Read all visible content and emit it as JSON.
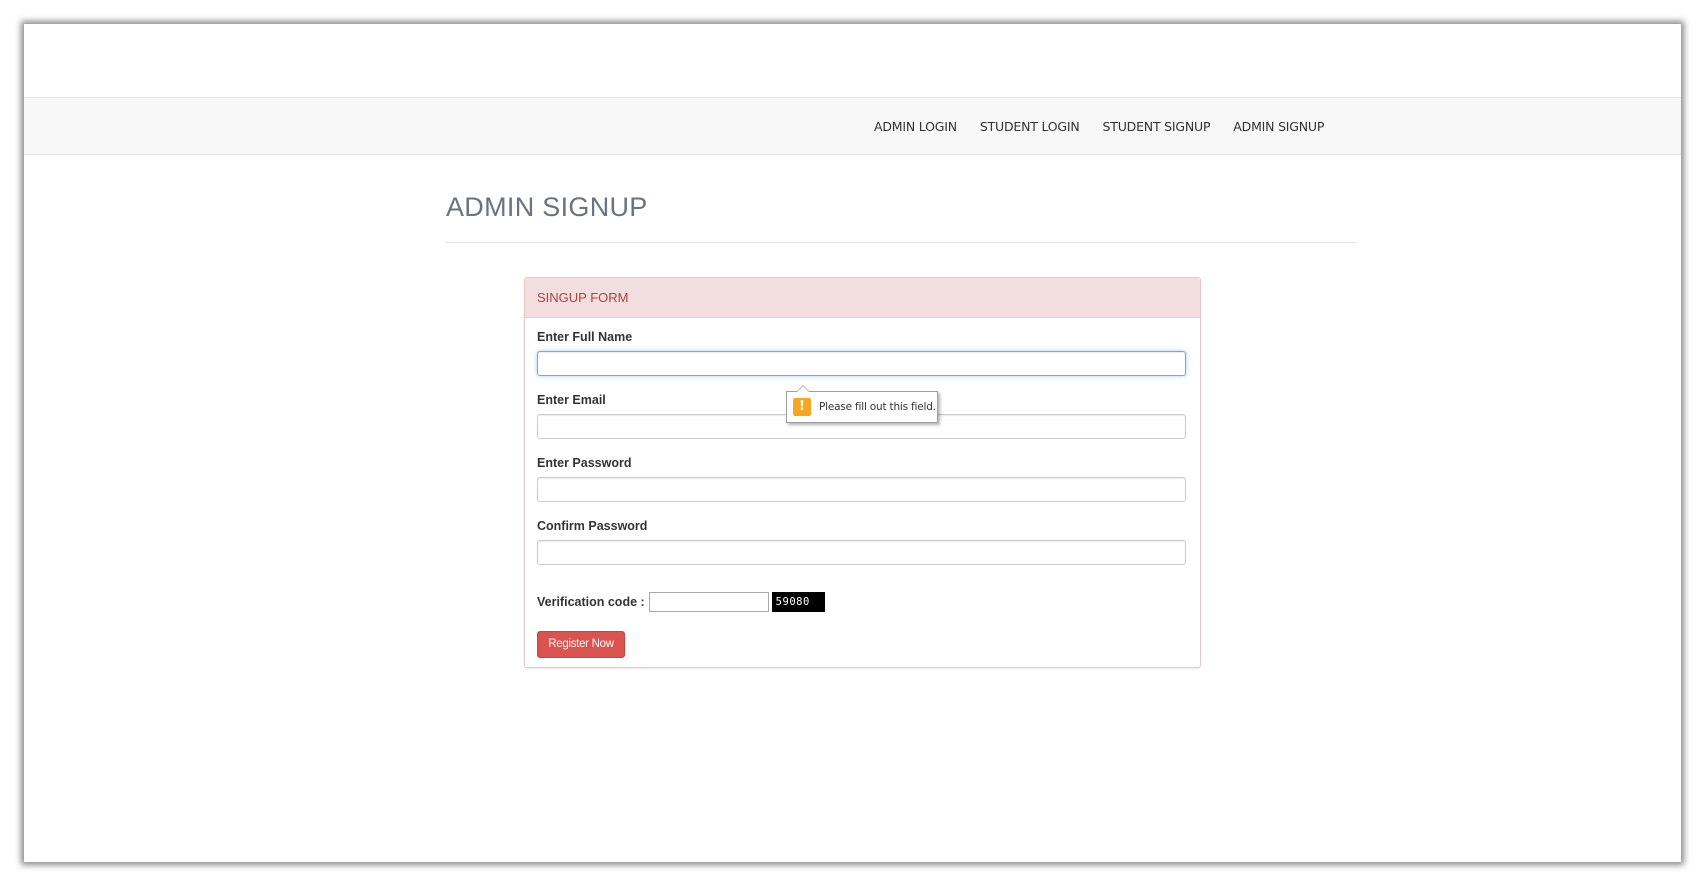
{
  "nav": {
    "items": [
      {
        "label": "ADMIN LOGIN"
      },
      {
        "label": "STUDENT LOGIN"
      },
      {
        "label": "STUDENT SIGNUP"
      },
      {
        "label": "ADMIN SIGNUP"
      }
    ]
  },
  "page": {
    "title": "ADMIN SIGNUP"
  },
  "form": {
    "heading": "SINGUP FORM",
    "full_name": {
      "label": "Enter Full Name",
      "value": ""
    },
    "email": {
      "label": "Enter Email",
      "value": ""
    },
    "password": {
      "label": "Enter Password",
      "value": ""
    },
    "confirm_password": {
      "label": "Confirm Password",
      "value": ""
    },
    "verification": {
      "label": "Verification code :",
      "value": "",
      "code": "59080"
    },
    "submit_label": "Register Now"
  },
  "validation_tooltip": {
    "icon": "warning-icon",
    "message": "Please fill out this field."
  },
  "colors": {
    "panel_heading_bg": "#f2dede",
    "panel_heading_text": "#a94442",
    "button_bg": "#d9534f",
    "warning": "#f5a623"
  }
}
